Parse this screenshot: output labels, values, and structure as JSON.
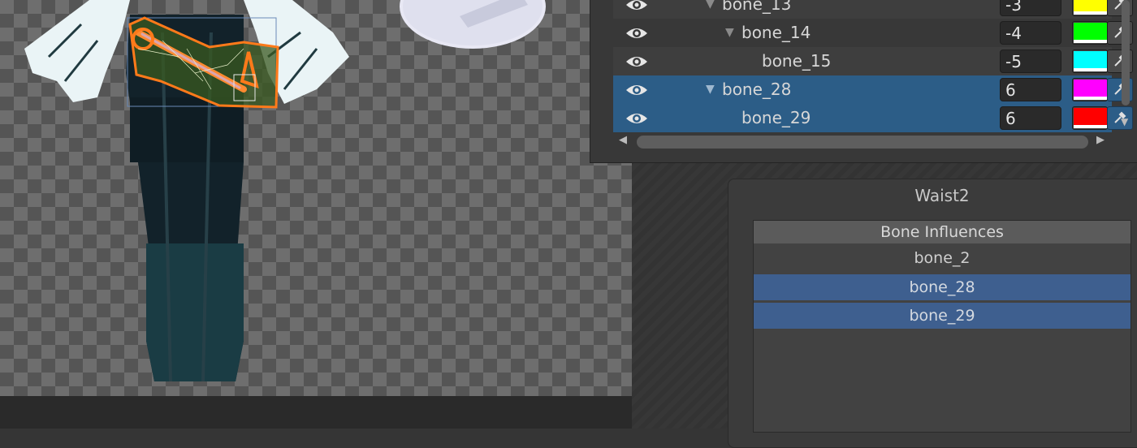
{
  "hierarchy": {
    "rows": [
      {
        "name": "bone_13",
        "depth": "-3",
        "color": "#ffff00",
        "selected": false
      },
      {
        "name": "bone_14",
        "depth": "-4",
        "color": "#00ff00",
        "selected": false
      },
      {
        "name": "bone_15",
        "depth": "-5",
        "color": "#00ffff",
        "selected": false
      },
      {
        "name": "bone_28",
        "depth": "6",
        "color": "#ff00ff",
        "selected": true
      },
      {
        "name": "bone_29",
        "depth": "6",
        "color": "#ff0000",
        "selected": true
      }
    ]
  },
  "waist": {
    "title": "Waist2",
    "influences_header": "Bone Influences",
    "influences": [
      {
        "name": "bone_2",
        "selected": false
      },
      {
        "name": "bone_28",
        "selected": true
      },
      {
        "name": "bone_29",
        "selected": true
      }
    ]
  },
  "icons": {
    "visibility": "eye-icon",
    "picker": "eyedropper-icon",
    "expand": "triangle-down-icon"
  }
}
